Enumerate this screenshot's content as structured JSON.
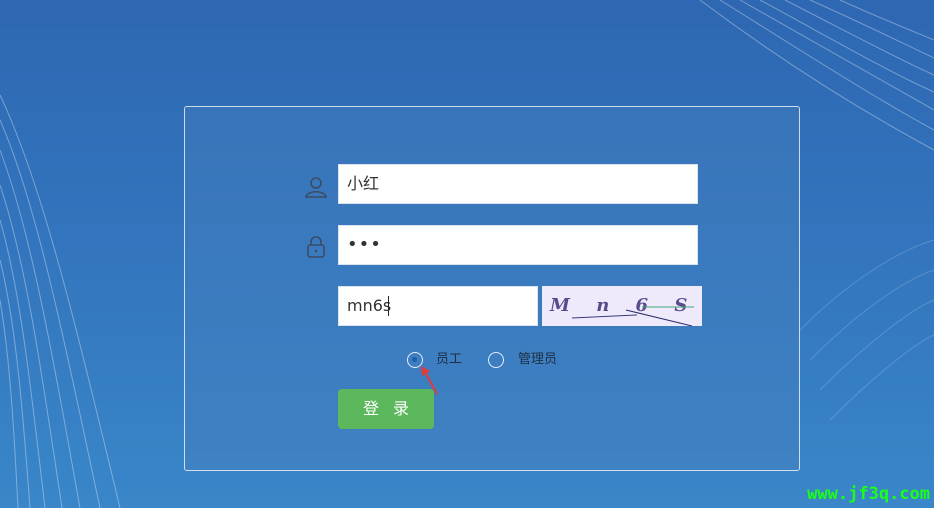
{
  "login": {
    "username_value": "小红",
    "password_mask": "•••",
    "captcha_value": "mn6s",
    "captcha_image_text": "M n 6 S",
    "roles": [
      {
        "label": "员工",
        "selected": true
      },
      {
        "label": "管理员",
        "selected": false
      }
    ],
    "submit_label": "登录"
  },
  "watermark": "www.jf3q.com",
  "colors": {
    "background": "#3274bd",
    "login_button": "#5cb85c",
    "watermark": "#1aff1a",
    "arrow": "#e03a3a"
  },
  "icons": {
    "username": "user-icon",
    "password": "lock-icon"
  }
}
